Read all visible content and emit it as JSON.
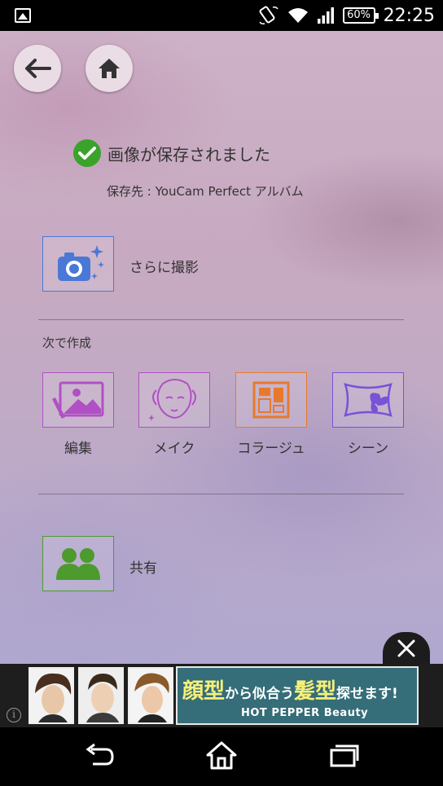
{
  "status_bar": {
    "battery": "60%",
    "time": "22:25"
  },
  "saved": {
    "title": "画像が保存されました",
    "destination": "保存先 : YouCam Perfect アルバム"
  },
  "actions": {
    "shoot_more": "さらに撮影",
    "create_next_heading": "次で作成",
    "share": "共有"
  },
  "create_items": [
    {
      "label": "編集",
      "color": "#b14fc5"
    },
    {
      "label": "メイク",
      "color": "#b14fc5"
    },
    {
      "label": "コラージュ",
      "color": "#e8792c"
    },
    {
      "label": "シーン",
      "color": "#7a52d6"
    }
  ],
  "colors": {
    "camera_tile": "#4a78d6",
    "share_tile": "#4d9a2d",
    "check": "#3aa32b"
  },
  "ad": {
    "headline_1": "顔型",
    "headline_2": "から似合う",
    "headline_3": "髪型",
    "headline_4": "探せます!",
    "brand": "HOT PEPPER Beauty"
  },
  "icons": [
    "back-arrow-icon",
    "home-icon",
    "check-icon",
    "camera-icon",
    "edit-image-icon",
    "makeup-face-icon",
    "collage-icon",
    "scene-butterfly-icon",
    "share-people-icon",
    "close-icon",
    "nav-back-icon",
    "nav-home-icon",
    "nav-recent-icon"
  ]
}
